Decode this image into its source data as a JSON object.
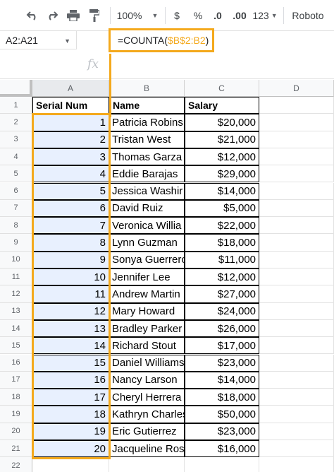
{
  "toolbar": {
    "undo_icon": "undo-icon",
    "redo_icon": "redo-icon",
    "print_icon": "print-icon",
    "paint_icon": "paint-format-icon",
    "zoom": "100%",
    "currency": "$",
    "percent": "%",
    "dec_decrease": ".0",
    "dec_increase": ".00",
    "more_formats": "123",
    "font": "Roboto"
  },
  "formula_bar": {
    "name_box": "A2:A21",
    "formula_prefix": "=COUNTA(",
    "formula_ref": "$B$2:B2",
    "formula_suffix": ")",
    "fx": "fx"
  },
  "columns": [
    "A",
    "B",
    "C",
    "D"
  ],
  "rows": [
    "1",
    "2",
    "3",
    "4",
    "5",
    "6",
    "7",
    "8",
    "9",
    "10",
    "11",
    "12",
    "13",
    "14",
    "15",
    "16",
    "17",
    "18",
    "19",
    "20",
    "21",
    "22"
  ],
  "headers": [
    "Serial Num",
    "Name",
    "Salary"
  ],
  "table": [
    {
      "serial": "1",
      "name": "Patricia Robins",
      "salary": "$20,000"
    },
    {
      "serial": "2",
      "name": "Tristan West",
      "salary": "$21,000"
    },
    {
      "serial": "3",
      "name": "Thomas Garza",
      "salary": "$12,000"
    },
    {
      "serial": "4",
      "name": "Eddie Barajas",
      "salary": "$29,000"
    },
    {
      "serial": "5",
      "name": "Jessica Washir",
      "salary": "$14,000"
    },
    {
      "serial": "6",
      "name": "David Ruiz",
      "salary": "$5,000"
    },
    {
      "serial": "7",
      "name": "Veronica Willia",
      "salary": "$22,000"
    },
    {
      "serial": "8",
      "name": "Lynn Guzman",
      "salary": "$18,000"
    },
    {
      "serial": "9",
      "name": "Sonya Guerrero",
      "salary": "$11,000"
    },
    {
      "serial": "10",
      "name": "Jennifer Lee",
      "salary": "$12,000"
    },
    {
      "serial": "11",
      "name": "Andrew Martin",
      "salary": "$27,000"
    },
    {
      "serial": "12",
      "name": "Mary Howard",
      "salary": "$24,000"
    },
    {
      "serial": "13",
      "name": "Bradley Parker",
      "salary": "$26,000"
    },
    {
      "serial": "14",
      "name": "Richard Stout",
      "salary": "$17,000"
    },
    {
      "serial": "15",
      "name": "Daniel Williams",
      "salary": "$23,000"
    },
    {
      "serial": "16",
      "name": "Nancy Larson",
      "salary": "$14,000"
    },
    {
      "serial": "17",
      "name": "Cheryl Herrera",
      "salary": "$18,000"
    },
    {
      "serial": "18",
      "name": "Kathryn Charles",
      "salary": "$50,000"
    },
    {
      "serial": "19",
      "name": "Eric Gutierrez",
      "salary": "$23,000"
    },
    {
      "serial": "20",
      "name": "Jacqueline Ros",
      "salary": "$16,000"
    }
  ],
  "colors": {
    "highlight": "#f4a91c",
    "selection": "#e8f0fe"
  }
}
